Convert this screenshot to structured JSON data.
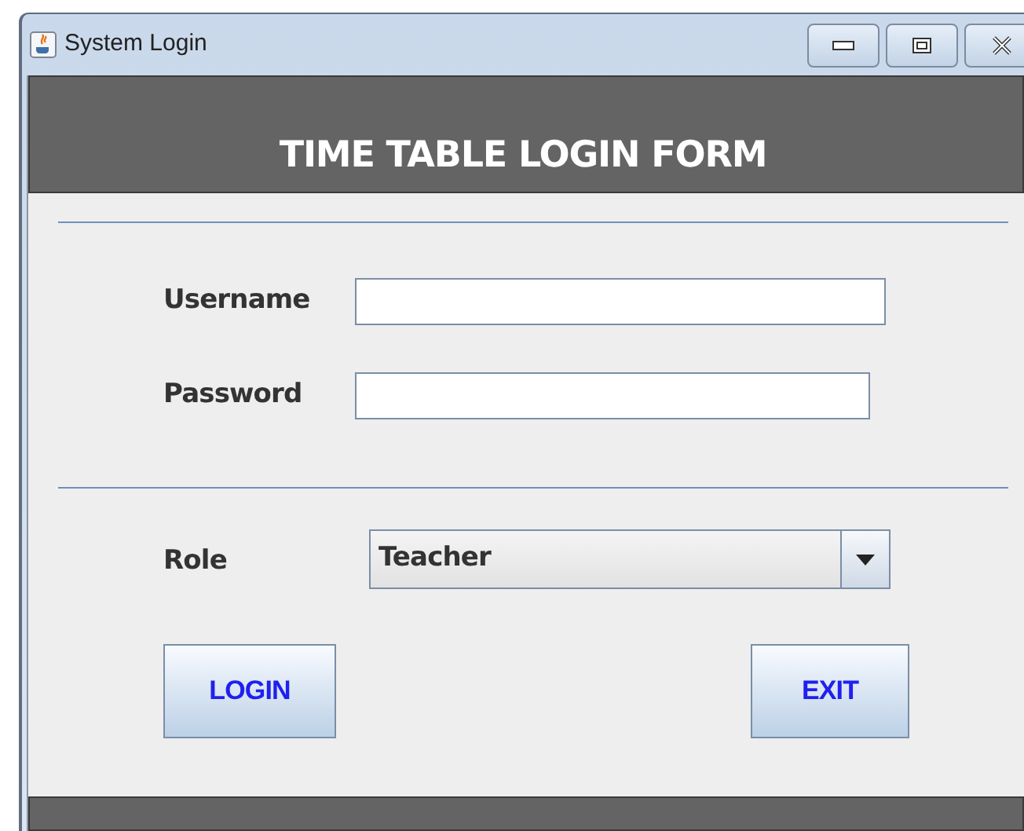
{
  "window": {
    "title": "System Login"
  },
  "header": {
    "title": "TIME TABLE LOGIN FORM"
  },
  "fields": [
    {
      "label": "Username"
    },
    {
      "label": "Password"
    }
  ],
  "role": {
    "label": "Role",
    "value": "Teacher"
  },
  "buttons": [
    "LOGIN",
    "EXIT"
  ]
}
